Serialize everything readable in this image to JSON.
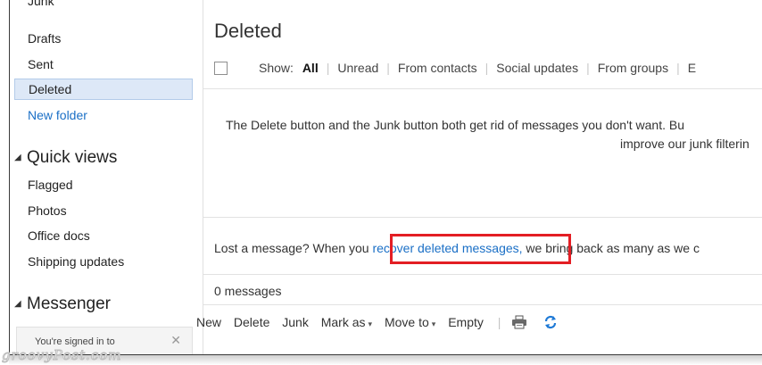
{
  "sidebar": {
    "items": [
      {
        "label": "Junk"
      },
      {
        "label": "Drafts"
      },
      {
        "label": "Sent"
      },
      {
        "label": "Deleted"
      },
      {
        "label": "New folder"
      }
    ],
    "quick_views": {
      "title": "Quick views",
      "items": [
        {
          "label": "Flagged"
        },
        {
          "label": "Photos"
        },
        {
          "label": "Office docs"
        },
        {
          "label": "Shipping updates"
        }
      ]
    },
    "messenger": {
      "title": "Messenger",
      "signin_text": "You're signed in to",
      "close_glyph": "✕"
    }
  },
  "main": {
    "title": "Deleted",
    "filter_label": "Show:",
    "filters": [
      "All",
      "Unread",
      "From contacts",
      "Social updates",
      "From groups",
      "E"
    ],
    "info_line1": "The Delete button and the Junk button both get rid of messages you don't want. Bu",
    "info_line2": "improve our junk filterin",
    "lost_prefix": "Lost a message? When you ",
    "lost_link": "recover deleted messages,",
    "lost_suffix": " we bring back as many as we c",
    "message_count": "0 messages"
  },
  "toolbar": {
    "new": "New",
    "delete": "Delete",
    "junk": "Junk",
    "mark_as": "Mark as",
    "move_to": "Move to",
    "empty": "Empty",
    "caret": "▾",
    "print_icon": "printer-icon",
    "sync_icon": "sync-icon"
  },
  "watermark": "groovyPost.com",
  "colors": {
    "accent_link": "#1a6fc6",
    "selected_bg": "#dde8f7",
    "highlight_box": "#e31e24",
    "sync_icon": "#1f7ad6"
  }
}
